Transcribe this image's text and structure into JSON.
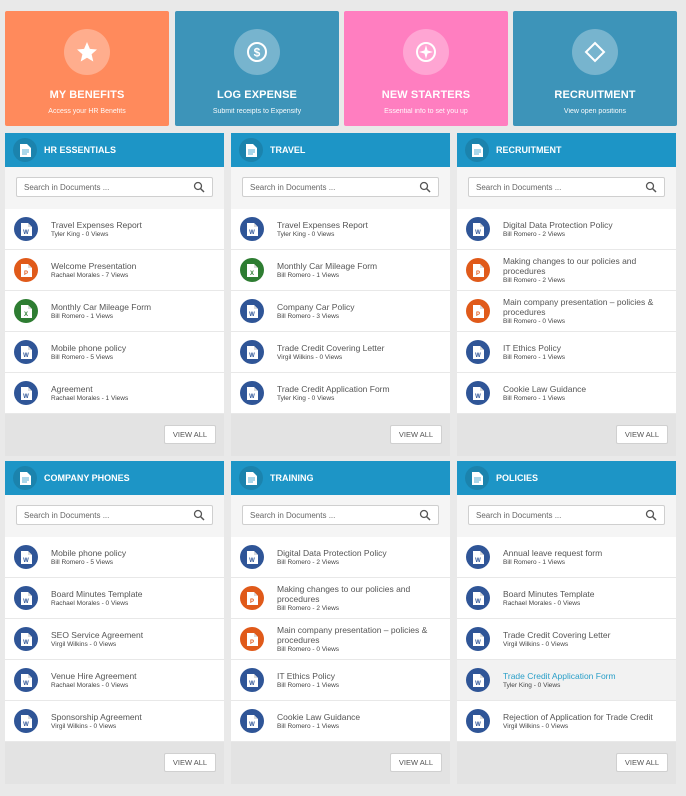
{
  "tiles": [
    {
      "title": "MY BENEFITS",
      "subtitle": "Access your HR Benefits",
      "color": "#ff8a5c",
      "icon": "star-icon"
    },
    {
      "title": "LOG EXPENSE",
      "subtitle": "Submit receipts to Expensify",
      "color": "#3d94b9",
      "icon": "dollar-icon"
    },
    {
      "title": "NEW STARTERS",
      "subtitle": "Essential info to set you up",
      "color": "#ff7ec0",
      "icon": "compass-icon"
    },
    {
      "title": "RECRUITMENT",
      "subtitle": "View open positions",
      "color": "#3d94b9",
      "icon": "diamond-icon"
    }
  ],
  "search_placeholder": "Search in Documents ...",
  "view_all_label": "VIEW ALL",
  "colors": {
    "header": "#1d95c6",
    "word": "#2f5597",
    "powerpoint": "#e05a1a",
    "excel": "#2e7d32",
    "link": "#2a9fc8"
  },
  "panels": [
    {
      "title": "HR ESSENTIALS",
      "items": [
        {
          "name": "Travel Expenses Report",
          "meta": "Tyler King - 0 Views",
          "type": "word"
        },
        {
          "name": "Welcome Presentation",
          "meta": "Rachael Morales - 7 Views",
          "type": "powerpoint"
        },
        {
          "name": "Monthly Car Mileage Form",
          "meta": "Bill Romero - 1 Views",
          "type": "excel"
        },
        {
          "name": "Mobile phone policy",
          "meta": "Bill Romero - 5 Views",
          "type": "word"
        },
        {
          "name": "Agreement",
          "meta": "Rachael Morales - 1 Views",
          "type": "word"
        }
      ]
    },
    {
      "title": "TRAVEL",
      "items": [
        {
          "name": "Travel Expenses Report",
          "meta": "Tyler King - 0 Views",
          "type": "word"
        },
        {
          "name": "Monthly Car Mileage Form",
          "meta": "Bill Romero - 1 Views",
          "type": "excel"
        },
        {
          "name": "Company Car Policy",
          "meta": "Bill Romero - 3 Views",
          "type": "word"
        },
        {
          "name": "Trade Credit Covering Letter",
          "meta": "Virgil Wilkins - 0 Views",
          "type": "word"
        },
        {
          "name": "Trade Credit Application Form",
          "meta": "Tyler King - 0 Views",
          "type": "word"
        }
      ]
    },
    {
      "title": "RECRUITMENT",
      "items": [
        {
          "name": "Digital Data Protection Policy",
          "meta": "Bill Romero - 2 Views",
          "type": "word"
        },
        {
          "name": "Making changes to our policies and procedures",
          "meta": "Bill Romero - 2 Views",
          "type": "powerpoint"
        },
        {
          "name": "Main company presentation – policies & procedures",
          "meta": "Bill Romero - 0 Views",
          "type": "powerpoint"
        },
        {
          "name": "IT Ethics Policy",
          "meta": "Bill Romero - 1 Views",
          "type": "word"
        },
        {
          "name": "Cookie Law Guidance",
          "meta": "Bill Romero - 1 Views",
          "type": "word"
        }
      ]
    },
    {
      "title": "COMPANY PHONES",
      "items": [
        {
          "name": "Mobile phone policy",
          "meta": "Bill Romero - 5 Views",
          "type": "word"
        },
        {
          "name": "Board Minutes Template",
          "meta": "Rachael Morales - 0 Views",
          "type": "word"
        },
        {
          "name": "SEO Service Agreement",
          "meta": "Virgil Wilkins - 0 Views",
          "type": "word"
        },
        {
          "name": "Venue Hire Agreement",
          "meta": "Rachael Morales - 0 Views",
          "type": "word"
        },
        {
          "name": "Sponsorship Agreement",
          "meta": "Virgil Wilkins - 0 Views",
          "type": "word"
        }
      ]
    },
    {
      "title": "TRAINING",
      "items": [
        {
          "name": "Digital Data Protection Policy",
          "meta": "Bill Romero - 2 Views",
          "type": "word"
        },
        {
          "name": "Making changes to our policies and procedures",
          "meta": "Bill Romero - 2 Views",
          "type": "powerpoint"
        },
        {
          "name": "Main company presentation – policies & procedures",
          "meta": "Bill Romero - 0 Views",
          "type": "powerpoint"
        },
        {
          "name": "IT Ethics Policy",
          "meta": "Bill Romero - 1 Views",
          "type": "word"
        },
        {
          "name": "Cookie Law Guidance",
          "meta": "Bill Romero - 1 Views",
          "type": "word"
        }
      ]
    },
    {
      "title": "POLICIES",
      "items": [
        {
          "name": "Annual leave request form",
          "meta": "Bill Romero - 1 Views",
          "type": "word"
        },
        {
          "name": "Board Minutes Template",
          "meta": "Rachael Morales - 0 Views",
          "type": "word"
        },
        {
          "name": "Trade Credit Covering Letter",
          "meta": "Virgil Wilkins - 0 Views",
          "type": "word"
        },
        {
          "name": "Trade Credit Application Form",
          "meta": "Tyler King - 0 Views",
          "type": "word",
          "highlighted": true
        },
        {
          "name": "Rejection of Application for Trade Credit",
          "meta": "Virgil Wilkins - 0 Views",
          "type": "word"
        }
      ]
    }
  ]
}
